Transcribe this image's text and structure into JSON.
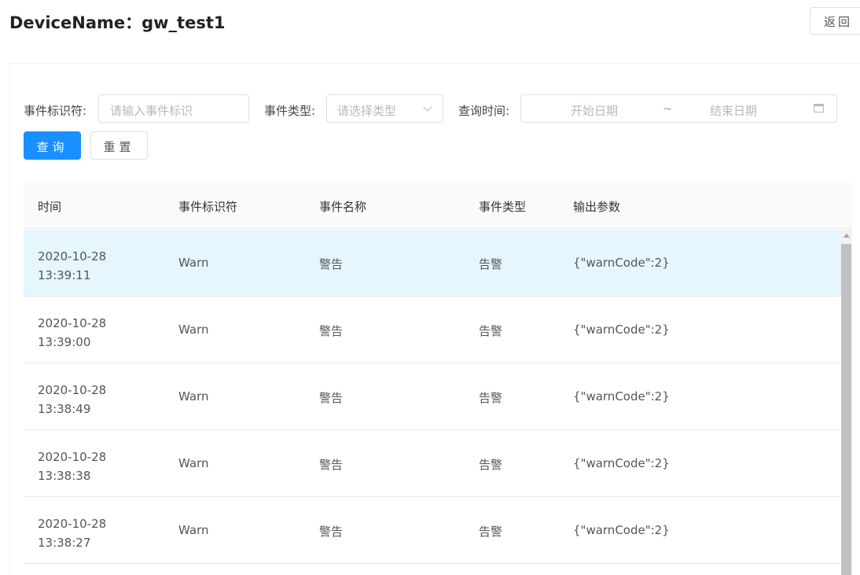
{
  "header": {
    "title": "DeviceName：gw_test1",
    "back_label": "返回"
  },
  "filters": {
    "identifier_label": "事件标识符:",
    "identifier_placeholder": "请输入事件标识",
    "type_label": "事件类型:",
    "type_placeholder": "请选择类型",
    "time_label": "查询时间:",
    "start_placeholder": "开始日期",
    "range_separator": "~",
    "end_placeholder": "结束日期",
    "query_label": "查询",
    "reset_label": "重置"
  },
  "table": {
    "columns": [
      "时间",
      "事件标识符",
      "事件名称",
      "事件类型",
      "输出参数"
    ],
    "rows": [
      {
        "date": "2020-10-28",
        "time": "13:39:11",
        "identifier": "Warn",
        "name": "警告",
        "type": "告警",
        "output": "{\"warnCode\":2}"
      },
      {
        "date": "2020-10-28",
        "time": "13:39:00",
        "identifier": "Warn",
        "name": "警告",
        "type": "告警",
        "output": "{\"warnCode\":2}"
      },
      {
        "date": "2020-10-28",
        "time": "13:38:49",
        "identifier": "Warn",
        "name": "警告",
        "type": "告警",
        "output": "{\"warnCode\":2}"
      },
      {
        "date": "2020-10-28",
        "time": "13:38:38",
        "identifier": "Warn",
        "name": "警告",
        "type": "告警",
        "output": "{\"warnCode\":2}"
      },
      {
        "date": "2020-10-28",
        "time": "13:38:27",
        "identifier": "Warn",
        "name": "警告",
        "type": "告警",
        "output": "{\"warnCode\":2}"
      }
    ]
  },
  "colors": {
    "primary": "#1890ff",
    "selected_row": "#e6f6fd"
  }
}
